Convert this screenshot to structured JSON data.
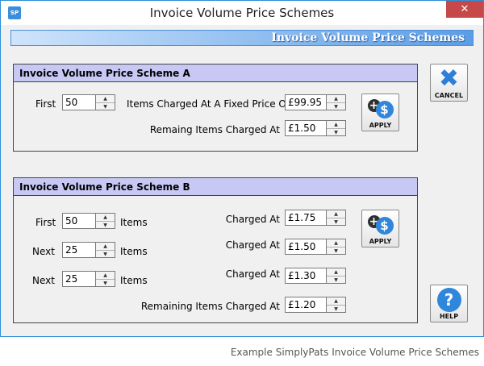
{
  "window": {
    "title": "Invoice Volume Price Schemes",
    "app_icon_text": "SP",
    "close_glyph": "✕"
  },
  "banner": {
    "title": "Invoice Volume Price Schemes"
  },
  "scheme_a": {
    "heading": "Invoice Volume Price Scheme A",
    "first_label": "First",
    "first_value": "50",
    "fixed_price_label": "Items Charged At A Fixed Price Of",
    "fixed_price_value": "£99.95",
    "remaining_label": "Remaing Items Charged At",
    "remaining_value": "£1.50",
    "apply_label": "APPLY"
  },
  "scheme_b": {
    "heading": "Invoice Volume Price Scheme B",
    "rows": [
      {
        "label": "First",
        "qty": "50",
        "items_label": "Items",
        "charged_label": "Charged At",
        "price": "£1.75"
      },
      {
        "label": "Next",
        "qty": "25",
        "items_label": "Items",
        "charged_label": "Charged At",
        "price": "£1.50"
      },
      {
        "label": "Next",
        "qty": "25",
        "items_label": "Items",
        "charged_label": "Charged At",
        "price": "£1.30"
      }
    ],
    "remaining_label": "Remaining Items Charged At",
    "remaining_value": "£1.20",
    "apply_label": "APPLY"
  },
  "buttons": {
    "cancel_label": "CANCEL",
    "help_label": "HELP",
    "help_glyph": "?"
  },
  "icons": {
    "close": "close-icon",
    "cancel": "cross-icon",
    "apply": "add-dollar-icon",
    "help": "question-mark-icon",
    "spinner_up": "▲",
    "spinner_down": "▼",
    "plus_glyph": "+",
    "dollar_glyph": "$",
    "cancel_glyph": "✖"
  },
  "colors": {
    "accent": "#2f86da",
    "panel_header": "#c8c8f5",
    "close_button": "#c74848"
  },
  "caption": "Example SimplyPats Invoice Volume Price Schemes"
}
